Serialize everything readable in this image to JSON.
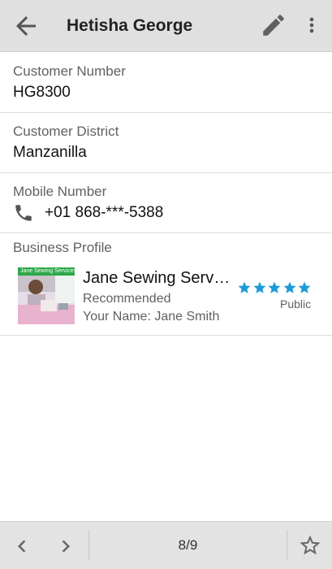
{
  "appbar": {
    "title": "Hetisha George",
    "icons": {
      "back": "arrow-back-icon",
      "edit": "pencil-icon",
      "more": "more-vert-icon"
    }
  },
  "customer_number": {
    "label": "Customer Number",
    "value": "HG8300"
  },
  "customer_district": {
    "label": "Customer District",
    "value": "Manzanilla"
  },
  "mobile_number": {
    "label": "Mobile Number",
    "value": "+01 868-***-5388",
    "icon": "phone-icon"
  },
  "business_profile": {
    "label": "Business Profile",
    "thumbnail_tag": "Jane Sewing Services",
    "name": "Jane Sewing Services",
    "status": "Recommended",
    "owner": "Your Name: Jane Smith",
    "rating": 5,
    "rating_max": 5,
    "visibility": "Public",
    "star_color": "#1e9bd7"
  },
  "bottom_bar": {
    "counter": "8/9",
    "icons": {
      "prev": "chevron-left-icon",
      "next": "chevron-right-icon",
      "favorite": "star-outline-icon"
    }
  },
  "colors": {
    "appbar_bg": "#e0e0e0",
    "bottombar_bg": "#e3e3e3",
    "divider": "#dcdcdc"
  }
}
